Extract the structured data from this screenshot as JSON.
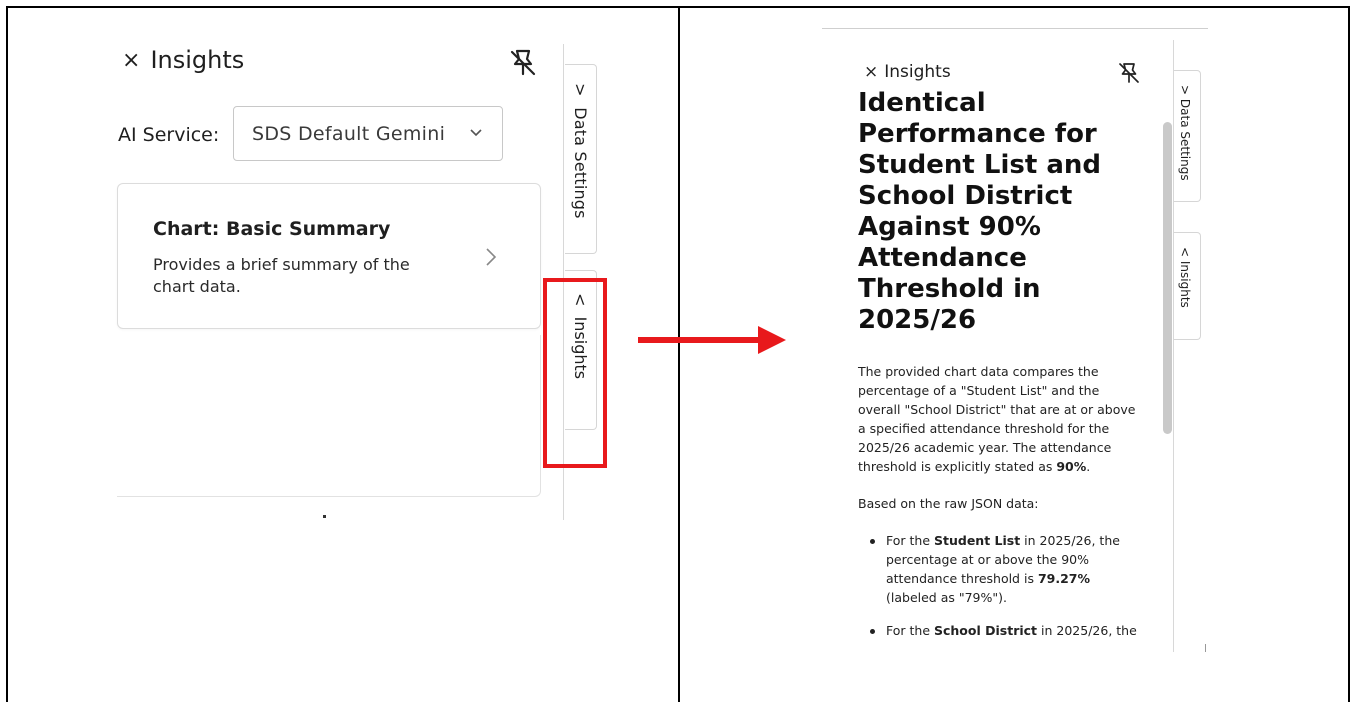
{
  "left_panel": {
    "title": "Insights",
    "close_glyph": "×",
    "pin_icon": "unpin-icon",
    "ai_service_label": "AI Service:",
    "ai_service_value": "SDS Default Gemini",
    "card": {
      "title": "Chart: Basic Summary",
      "description": "Provides a brief summary of the chart data."
    },
    "side_tabs": {
      "data_settings": "Data Settings",
      "insights": "Insights",
      "data_settings_chevron": ">",
      "insights_chevron": "<"
    },
    "highlight_color": "#e8191c"
  },
  "arrow": {
    "color": "#e8191c"
  },
  "right_panel": {
    "title": "Insights",
    "close_glyph": "×",
    "heading": "Identical Performance for Student List and School District Against 90% Attendance Threshold in 2025/26",
    "paragraph1_a": "The provided chart data compares the percentage of a \"Student List\" and the overall \"School District\" that are at or above a specified attendance threshold for the 2025/26 academic year. The attendance threshold is explicitly stated as ",
    "paragraph1_bold": "90%",
    "paragraph1_end": ".",
    "paragraph2": "Based on the raw JSON data:",
    "bullets": [
      {
        "a": "For the ",
        "bold1": "Student List",
        "b": " in 2025/26, the percentage at or above the 90% attendance threshold is ",
        "bold2": "79.27%",
        "c": " (labeled as \"79%\")."
      },
      {
        "a": "For the ",
        "bold1": "School District",
        "b": " in 2025/26, the"
      }
    ],
    "side_tabs": {
      "data_settings": "Data Settings",
      "insights": "Insights",
      "data_settings_chevron": ">",
      "insights_chevron": "<"
    }
  }
}
